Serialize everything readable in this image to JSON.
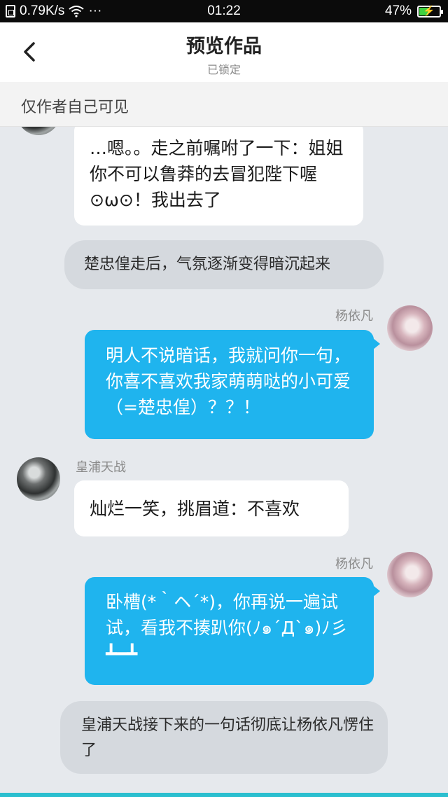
{
  "status_bar": {
    "network_speed": "0.79K/s",
    "more": "···",
    "time": "01:22",
    "battery_percent": "47%",
    "battery_level": 0.47
  },
  "header": {
    "title": "预览作品",
    "subtitle": "已锁定"
  },
  "visibility_note": "仅作者自己可见",
  "messages": [
    {
      "type": "incoming",
      "text": "…嗯。。走之前嘱咐了一下：姐姐你不可以鲁莽的去冒犯陛下喔⊙ω⊙！我出去了"
    },
    {
      "type": "narration",
      "text": "楚忠偟走后，气氛逐渐变得暗沉起来"
    },
    {
      "type": "outgoing",
      "sender": "杨依凡",
      "text": "明人不说暗话，我就问你一句，你喜不喜欢我家萌萌哒的小可爱（=楚忠偟）？？！"
    },
    {
      "type": "incoming",
      "sender": "皇浦天战",
      "text": "灿烂一笑，挑眉道：不喜欢"
    },
    {
      "type": "outgoing",
      "sender": "杨依凡",
      "text": "卧槽(*｀ヘ´*)，你再说一遍试试，看我不揍趴你(ﾉ๑´Д`๑)ﾉ彡┻━┻"
    },
    {
      "type": "narration",
      "text": "皇浦天战接下来的一句话彻底让杨依凡愣住了"
    }
  ]
}
